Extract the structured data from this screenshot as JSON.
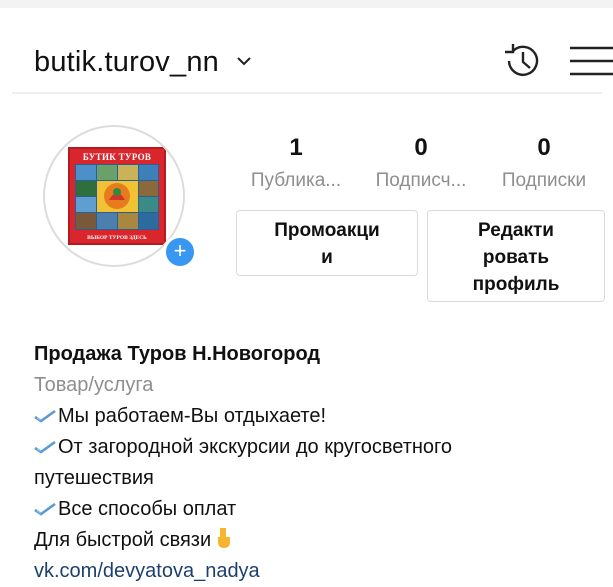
{
  "header": {
    "username": "butik.turov_nn",
    "dropdown_icon": "chevron-down-icon",
    "history_icon": "history-icon",
    "menu_icon": "hamburger-menu-icon"
  },
  "profile": {
    "avatar": {
      "logo_top_text": "БУТИК ТУРОВ",
      "logo_bottom_text": "ВЫБОР ТУРОВ ЗДЕСЬ",
      "add_icon": "plus-icon"
    },
    "stats": [
      {
        "value": "1",
        "label": "Публика..."
      },
      {
        "value": "0",
        "label": "Подписч..."
      },
      {
        "value": "0",
        "label": "Подписки"
      }
    ],
    "buttons": {
      "promo": [
        "Промоакци",
        "и"
      ],
      "edit": [
        "Редакти",
        "ровать",
        "профиль"
      ]
    }
  },
  "bio": {
    "name": "Продажа Туров Н.Новогород",
    "category": "Товар/услуга",
    "lines": [
      "Мы работаем-Вы отдыхаете!",
      "От загородной экскурсии до кругосветного",
      "путешествия",
      "Все способы оплат",
      "Для быстрой связи"
    ],
    "link": "vk.com/devyatova_nadya"
  },
  "colors": {
    "accent": "#3897f0",
    "secondary_text": "#8e8e8e",
    "link": "#1d3f6e",
    "logo_red": "#d9262c"
  }
}
